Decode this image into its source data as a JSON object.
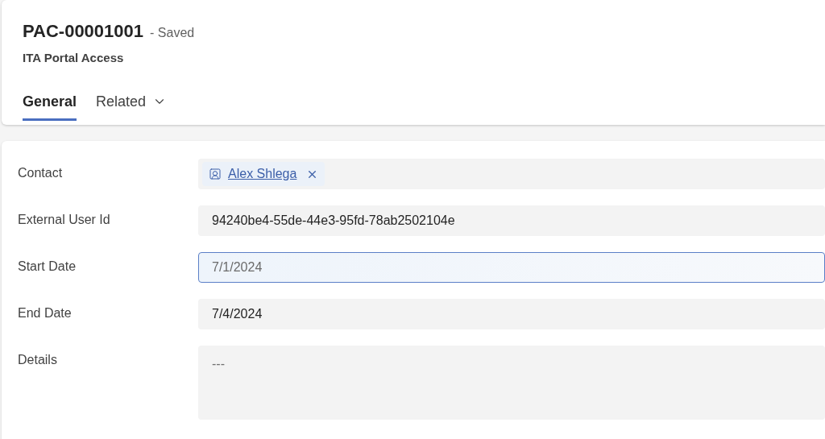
{
  "header": {
    "title": "PAC-00001001",
    "status": "- Saved",
    "entity": "ITA Portal Access"
  },
  "tabs": [
    {
      "label": "General",
      "selected": true,
      "has_menu": false
    },
    {
      "label": "Related",
      "selected": false,
      "has_menu": true
    }
  ],
  "fields": [
    {
      "label": "Contact",
      "kind": "lookup",
      "value": "Alex Shlega",
      "focused": false
    },
    {
      "label": "External User Id",
      "kind": "text",
      "value": "94240be4-55de-44e3-95fd-78ab2502104e",
      "focused": false
    },
    {
      "label": "Start Date",
      "kind": "text",
      "value": "7/1/2024",
      "focused": true
    },
    {
      "label": "End Date",
      "kind": "text",
      "value": "7/4/2024",
      "focused": false
    },
    {
      "label": "Details",
      "kind": "multiline",
      "placeholder": "---",
      "focused": false
    }
  ]
}
